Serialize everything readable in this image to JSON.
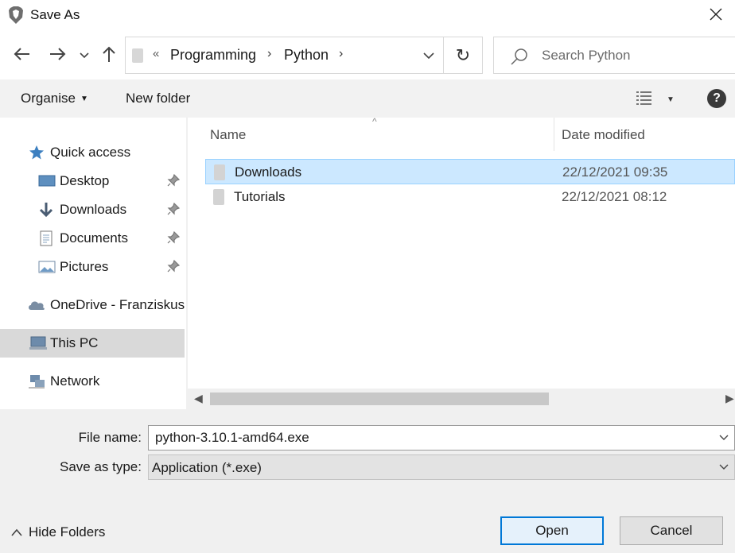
{
  "window": {
    "title": "Save As",
    "close_icon": "close-icon",
    "app_icon": "brave-browser-icon"
  },
  "navigation": {
    "back_icon": "back-arrow-icon",
    "forward_icon": "forward-arrow-icon",
    "recent_icon": "chevron-down-icon",
    "up_icon": "up-arrow-icon",
    "breadcrumb": {
      "overflow": "«",
      "items": [
        "Programming",
        "Python"
      ],
      "separator": "›"
    },
    "refresh_icon": "refresh-icon",
    "refresh_glyph": "↻",
    "search_placeholder": "Search Python"
  },
  "toolbar": {
    "organise_label": "Organise",
    "new_folder_label": "New folder",
    "view_icon": "details-view-icon",
    "help_label": "?"
  },
  "sidebar": {
    "items": [
      {
        "label": "Quick access",
        "icon": "star-icon"
      },
      {
        "label": "Desktop",
        "icon": "desktop-icon",
        "pinned": true
      },
      {
        "label": "Downloads",
        "icon": "download-arrow-icon",
        "pinned": true
      },
      {
        "label": "Documents",
        "icon": "document-icon",
        "pinned": true
      },
      {
        "label": "Pictures",
        "icon": "pictures-icon",
        "pinned": true
      },
      {
        "label": "OneDrive - Franziskus",
        "icon": "cloud-icon"
      },
      {
        "label": "This PC",
        "icon": "computer-icon",
        "selected": true
      },
      {
        "label": "Network",
        "icon": "network-icon"
      }
    ]
  },
  "filelist": {
    "columns": [
      "Name",
      "Date modified"
    ],
    "sort_indicator": "^",
    "rows": [
      {
        "name": "Downloads",
        "date": "22/12/2021 09:35",
        "selected": true
      },
      {
        "name": "Tutorials",
        "date": "22/12/2021 08:12",
        "selected": false
      }
    ]
  },
  "form": {
    "file_name_label": "File name:",
    "file_name_value": "python-3.10.1-amd64.exe",
    "save_type_label": "Save as type:",
    "save_type_value": "Application (*.exe)"
  },
  "footer": {
    "hide_folders_label": "Hide Folders",
    "open_label": "Open",
    "cancel_label": "Cancel"
  },
  "colors": {
    "selection": "#cce8ff",
    "selection_border": "#99d1ff",
    "primary_button_border": "#0078d7",
    "toolbar_bg": "#f2f2f2"
  }
}
